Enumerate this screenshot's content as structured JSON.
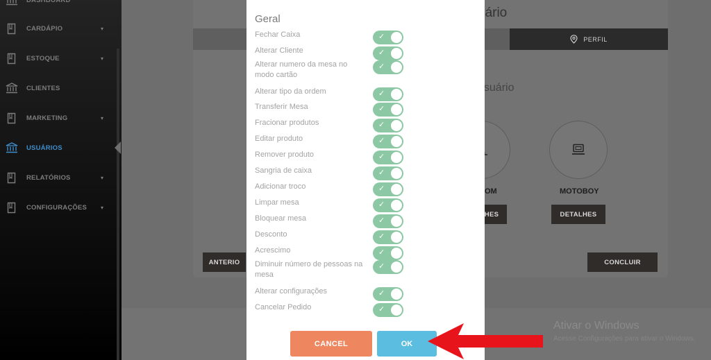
{
  "sidebar": {
    "items": [
      {
        "label": "DASHBOARD",
        "icon": "dashboard-icon",
        "caret": false
      },
      {
        "label": "CARDÁPIO",
        "icon": "book-icon",
        "caret": true
      },
      {
        "label": "ESTOQUE",
        "icon": "book-icon",
        "caret": true
      },
      {
        "label": "CLIENTES",
        "icon": "bank-icon",
        "caret": false
      },
      {
        "label": "MARKETING",
        "icon": "book-icon",
        "caret": true
      },
      {
        "label": "USUÁRIOS",
        "icon": "bank-icon",
        "caret": false,
        "active": true
      },
      {
        "label": "RELATÓRIOS",
        "icon": "book-icon",
        "caret": true
      },
      {
        "label": "CONFIGURAÇÕES",
        "icon": "book-icon",
        "caret": true
      }
    ],
    "caret_glyph": "▾"
  },
  "background": {
    "title_fragment": "uário",
    "tab_label": "PERFIL",
    "subtitle_fragment": "usuário",
    "role_partial_label": "OM",
    "role_motoboy_label": "MOTOBOY",
    "details_partial_label": "HES",
    "details_label": "DETALHES",
    "prev_partial_label": "ANTERIO",
    "finish_label": "CONCLUIR"
  },
  "watermark": {
    "title": "Ativar o Windows",
    "subtitle": "Acesse Configurações para ativar o Windows."
  },
  "modal": {
    "title": "Geral",
    "permissions": [
      {
        "label": "Fechar Caixa",
        "enabled": true
      },
      {
        "label": "Alterar Cliente",
        "enabled": true
      },
      {
        "label": "Alterar numero da mesa no modo cartão",
        "enabled": true
      },
      {
        "label": "Alterar tipo da ordem",
        "enabled": true
      },
      {
        "label": "Transferir Mesa",
        "enabled": true
      },
      {
        "label": "Fracionar produtos",
        "enabled": true
      },
      {
        "label": "Editar produto",
        "enabled": true
      },
      {
        "label": "Remover produto",
        "enabled": true
      },
      {
        "label": "Sangria de caixa",
        "enabled": true
      },
      {
        "label": "Adicionar troco",
        "enabled": true
      },
      {
        "label": "Limpar mesa",
        "enabled": true
      },
      {
        "label": "Bloquear mesa",
        "enabled": true
      },
      {
        "label": "Desconto",
        "enabled": true
      },
      {
        "label": "Acrescimo",
        "enabled": true
      },
      {
        "label": "Diminuir número de pessoas na mesa",
        "enabled": true
      },
      {
        "label": "Alterar configurações",
        "enabled": true
      },
      {
        "label": "Cancelar Pedido",
        "enabled": true
      }
    ],
    "check_glyph": "✓",
    "cancel_label": "CANCEL",
    "ok_label": "OK"
  },
  "colors": {
    "toggle_on": "#8cc8a3",
    "cancel": "#ee8760",
    "ok": "#5bbde0",
    "active_nav": "#3e8ecb",
    "annotation_arrow": "#e8141b"
  }
}
